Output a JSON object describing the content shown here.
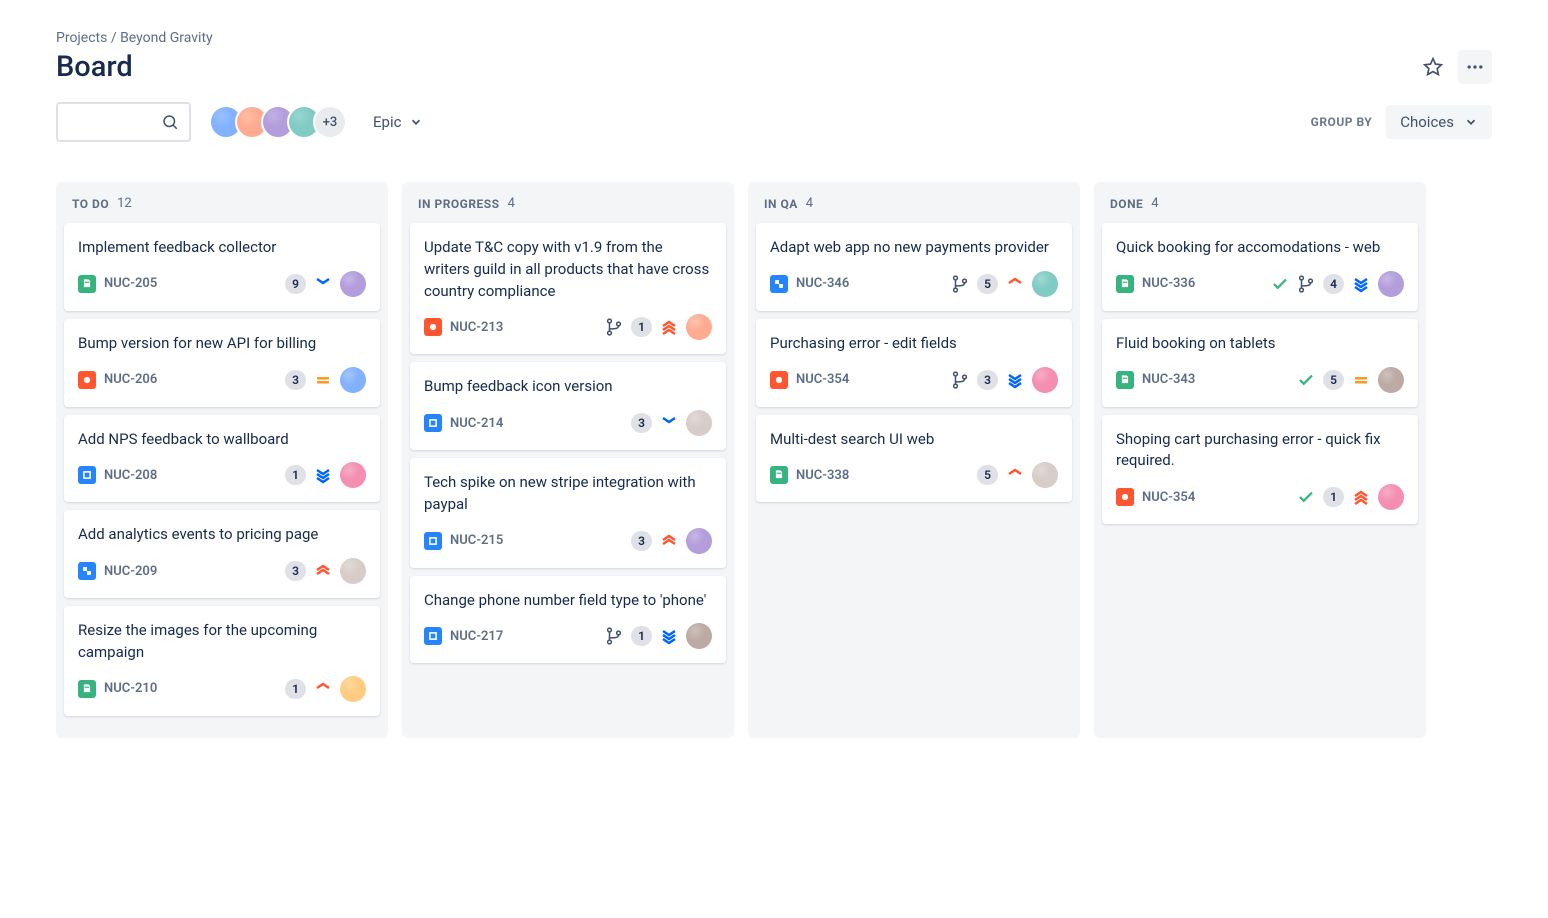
{
  "breadcrumb": {
    "root": "Projects",
    "project": "Beyond Gravity"
  },
  "title": "Board",
  "toolbar": {
    "epic_label": "Epic",
    "group_by_label": "GROUP BY",
    "choices_label": "Choices",
    "avatar_more": "+3",
    "avatar_colors": [
      "#82B1FF",
      "#FFAB91",
      "#B39DDB",
      "#80CBC4"
    ]
  },
  "columns": [
    {
      "name": "TO DO",
      "count": "12",
      "cards": [
        {
          "title": "Implement feedback collector",
          "key": "NUC-205",
          "type": "story",
          "count": "9",
          "priority": "low",
          "done": false,
          "branch": false,
          "avatar": "#B39DDB"
        },
        {
          "title": "Bump version for new API for billing",
          "key": "NUC-206",
          "type": "bug",
          "count": "3",
          "priority": "medium",
          "done": false,
          "branch": false,
          "avatar": "#82B1FF"
        },
        {
          "title": "Add NPS feedback to wallboard",
          "key": "NUC-208",
          "type": "task",
          "count": "1",
          "priority": "lowest",
          "done": false,
          "branch": false,
          "avatar": "#F48FB1"
        },
        {
          "title": "Add analytics events to pricing page",
          "key": "NUC-209",
          "type": "subtask",
          "count": "3",
          "priority": "high",
          "done": false,
          "branch": false,
          "avatar": "#D7CCC8"
        },
        {
          "title": "Resize the images for the upcoming campaign",
          "key": "NUC-210",
          "type": "story",
          "count": "1",
          "priority": "mediumup",
          "done": false,
          "branch": false,
          "avatar": "#FFCC80"
        }
      ]
    },
    {
      "name": "IN PROGRESS",
      "count": "4",
      "cards": [
        {
          "title": "Update T&C copy with v1.9 from the writers guild in all products that have cross country compliance",
          "key": "NUC-213",
          "type": "bug",
          "count": "1",
          "priority": "highest",
          "done": false,
          "branch": true,
          "avatar": "#FFAB91"
        },
        {
          "title": "Bump feedback icon version",
          "key": "NUC-214",
          "type": "task",
          "count": "3",
          "priority": "low",
          "done": false,
          "branch": false,
          "avatar": "#D7CCC8"
        },
        {
          "title": "Tech spike on new stripe integration with paypal",
          "key": "NUC-215",
          "type": "task",
          "count": "3",
          "priority": "high",
          "done": false,
          "branch": false,
          "avatar": "#B39DDB"
        },
        {
          "title": "Change phone number field type to 'phone'",
          "key": "NUC-217",
          "type": "task",
          "count": "1",
          "priority": "lowest",
          "done": false,
          "branch": true,
          "avatar": "#BCAAA4"
        }
      ]
    },
    {
      "name": "IN QA",
      "count": "4",
      "cards": [
        {
          "title": "Adapt web app no new payments provider",
          "key": "NUC-346",
          "type": "subtask",
          "count": "5",
          "priority": "mediumup",
          "done": false,
          "branch": true,
          "avatar": "#80CBC4"
        },
        {
          "title": "Purchasing error - edit fields",
          "key": "NUC-354",
          "type": "bug",
          "count": "3",
          "priority": "lowest",
          "done": false,
          "branch": true,
          "avatar": "#F48FB1"
        },
        {
          "title": "Multi-dest search UI web",
          "key": "NUC-338",
          "type": "story",
          "count": "5",
          "priority": "mediumup",
          "done": false,
          "branch": false,
          "avatar": "#D7CCC8"
        }
      ]
    },
    {
      "name": "DONE",
      "count": "4",
      "cards": [
        {
          "title": "Quick booking for accomodations - web",
          "key": "NUC-336",
          "type": "story",
          "count": "4",
          "priority": "lowest",
          "done": true,
          "branch": true,
          "avatar": "#B39DDB"
        },
        {
          "title": "Fluid booking on tablets",
          "key": "NUC-343",
          "type": "story",
          "count": "5",
          "priority": "medium",
          "done": true,
          "branch": false,
          "avatar": "#BCAAA4"
        },
        {
          "title": "Shoping cart purchasing error - quick fix required.",
          "key": "NUC-354",
          "type": "bug",
          "count": "1",
          "priority": "highest",
          "done": true,
          "branch": false,
          "avatar": "#F48FB1"
        }
      ]
    }
  ]
}
